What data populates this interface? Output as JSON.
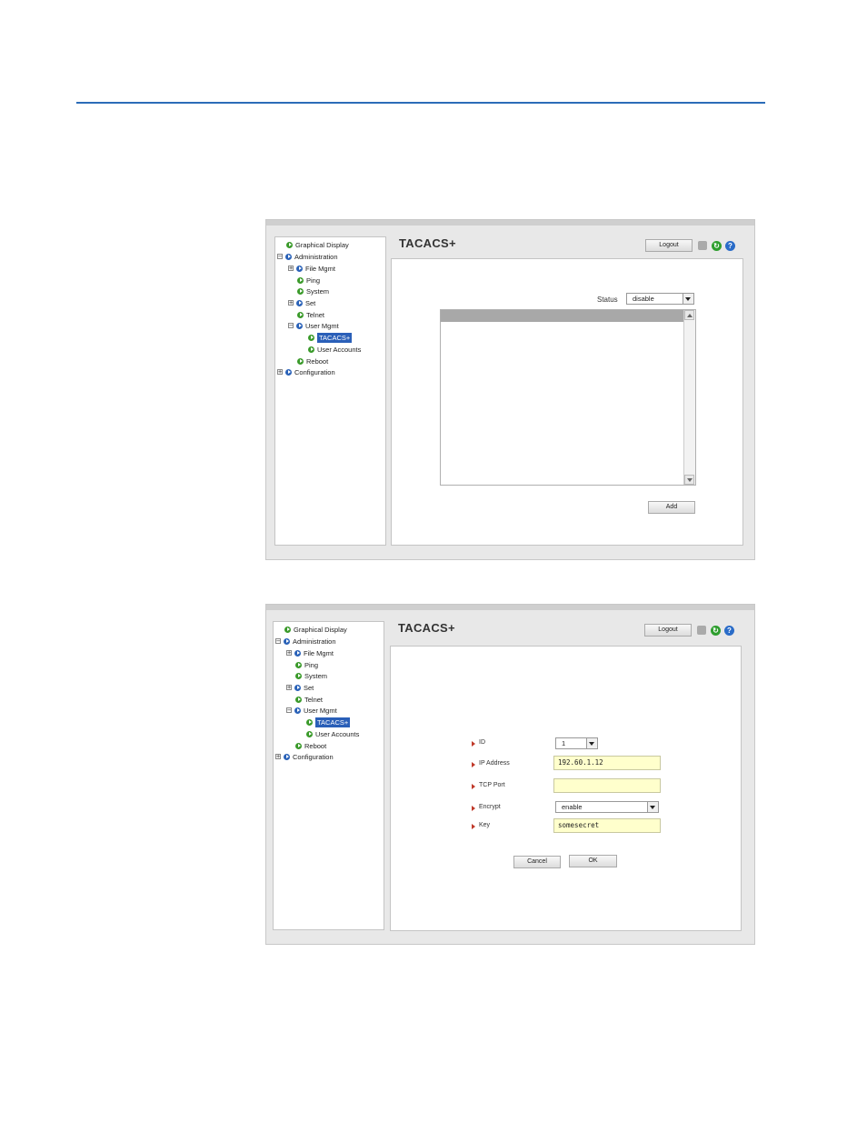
{
  "tree": {
    "items": [
      {
        "label": "Graphical Display",
        "key": "graphical"
      },
      {
        "label": "Administration",
        "key": "admin"
      },
      {
        "label": "File Mgmt",
        "key": "file"
      },
      {
        "label": "Ping",
        "key": "ping"
      },
      {
        "label": "System",
        "key": "system"
      },
      {
        "label": "Set",
        "key": "set"
      },
      {
        "label": "Telnet",
        "key": "telnet"
      },
      {
        "label": "User Mgmt",
        "key": "usermgmt"
      },
      {
        "label": "TACACS+",
        "key": "tacacs"
      },
      {
        "label": "User Accounts",
        "key": "useraccounts"
      },
      {
        "label": "Reboot",
        "key": "reboot"
      },
      {
        "label": "Configuration",
        "key": "configuration"
      }
    ]
  },
  "panel1": {
    "title": "TACACS+",
    "logout_label": "Logout",
    "status_label": "Status",
    "status_value": "disable",
    "add_label": "Add"
  },
  "panel2": {
    "title": "TACACS+",
    "logout_label": "Logout",
    "form": {
      "id_label": "ID",
      "id_value": "1",
      "ip_label": "IP Address",
      "ip_value": "192.60.1.12",
      "port_label": "TCP Port",
      "port_value": "",
      "encrypt_label": "Encrypt",
      "encrypt_value": "enable",
      "key_label": "Key",
      "key_value": "somesecret"
    },
    "cancel_label": "Cancel",
    "ok_label": "OK"
  },
  "icons": {
    "save": "save-icon",
    "refresh": "refresh-icon",
    "help": "help-icon",
    "help_glyph": "?",
    "refresh_glyph": "↻"
  },
  "colors": {
    "accent_rule": "#2b6cb8",
    "selected_bg": "#2a5fb8",
    "input_bg": "#ffffcc"
  }
}
